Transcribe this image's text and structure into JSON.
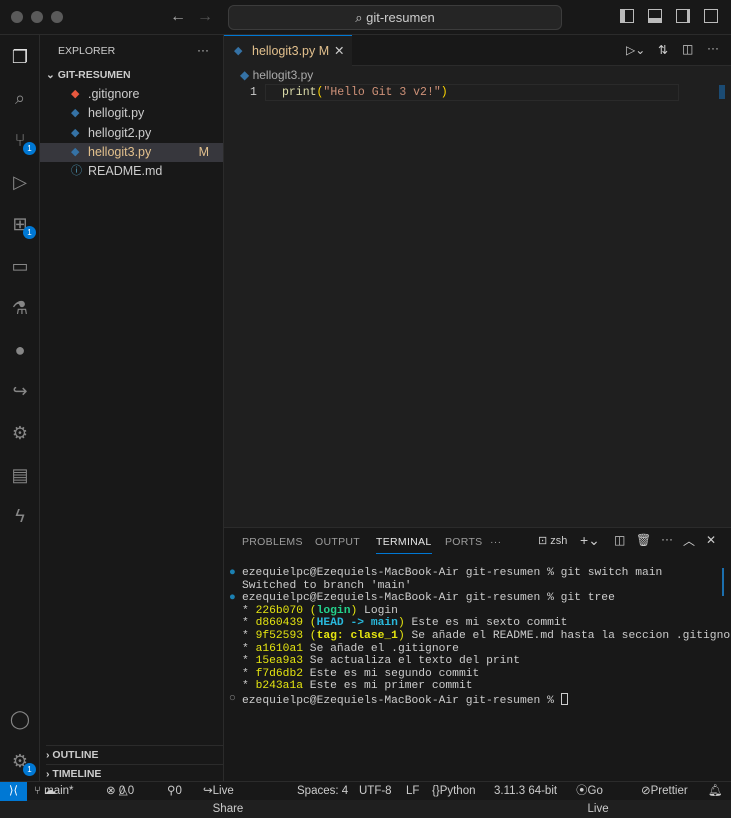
{
  "window": {
    "search": "git-resumen"
  },
  "activity": {
    "scm_badge": "1",
    "extensions_badge": "1",
    "settings_badge": "1"
  },
  "explorer": {
    "title": "EXPLORER",
    "more": "···",
    "folder": "GIT-RESUMEN",
    "files": [
      {
        "name": ".gitignore",
        "icon": "git-icon",
        "color": "#e8583e",
        "status": ""
      },
      {
        "name": "hellogit.py",
        "icon": "python-icon",
        "color": "#3572a5",
        "status": ""
      },
      {
        "name": "hellogit2.py",
        "icon": "python-icon",
        "color": "#3572a5",
        "status": ""
      },
      {
        "name": "hellogit3.py",
        "icon": "python-icon",
        "color": "#3572a5",
        "status": "M"
      },
      {
        "name": "README.md",
        "icon": "info-icon",
        "color": "#519aba",
        "status": ""
      }
    ],
    "outline": "OUTLINE",
    "timeline": "TIMELINE"
  },
  "editor": {
    "tab": "hellogit3.py",
    "tab_status": "M",
    "breadcrumb": "hellogit3.py",
    "line_no": "1",
    "code_fn": "print",
    "code_open": "(",
    "code_str": "\"Hello Git 3 v2!\"",
    "code_close": ")"
  },
  "panel": {
    "tabs": [
      "PROBLEMS",
      "OUTPUT",
      "TERMINAL",
      "PORTS"
    ],
    "more": "···",
    "shell": "zsh",
    "prompt": "ezequielpc@Ezequiels-MacBook-Air git-resumen % ",
    "cmd1": "git switch main",
    "out1": "Switched to branch 'main'",
    "cmd2": "git tree",
    "commits": [
      {
        "hash": "226b070",
        "ref_open": " (",
        "ref": "login",
        "ref_close": ")",
        "msg": " Login"
      },
      {
        "hash": "d860439",
        "ref_open": " (",
        "ref": "HEAD -> main",
        "ref_close": ")",
        "msg": " Este es mi sexto commit"
      },
      {
        "hash": "9f52593",
        "ref_open": " (",
        "ref": "tag: clase_1",
        "ref_close": ")",
        "msg": " Se añade el README.md hasta la seccion .gitignore"
      },
      {
        "hash": "a1610a1",
        "msg": " Se añade el .gitignore"
      },
      {
        "hash": "15ea9a3",
        "msg": " Se actualiza el texto del print"
      },
      {
        "hash": "f7d6db2",
        "msg": " Este es mi segundo commit"
      },
      {
        "hash": "b243a1a",
        "msg": " Este es mi primer commit"
      }
    ]
  },
  "status": {
    "branch": "main*",
    "errors": "0",
    "warnings": "0",
    "ports": "0",
    "liveshare": "Live Share",
    "spaces": "Spaces: 4",
    "encoding": "UTF-8",
    "eol": "LF",
    "language": "Python",
    "interpreter": "3.11.3 64-bit",
    "golive": "Go Live",
    "prettier": "Prettier"
  }
}
